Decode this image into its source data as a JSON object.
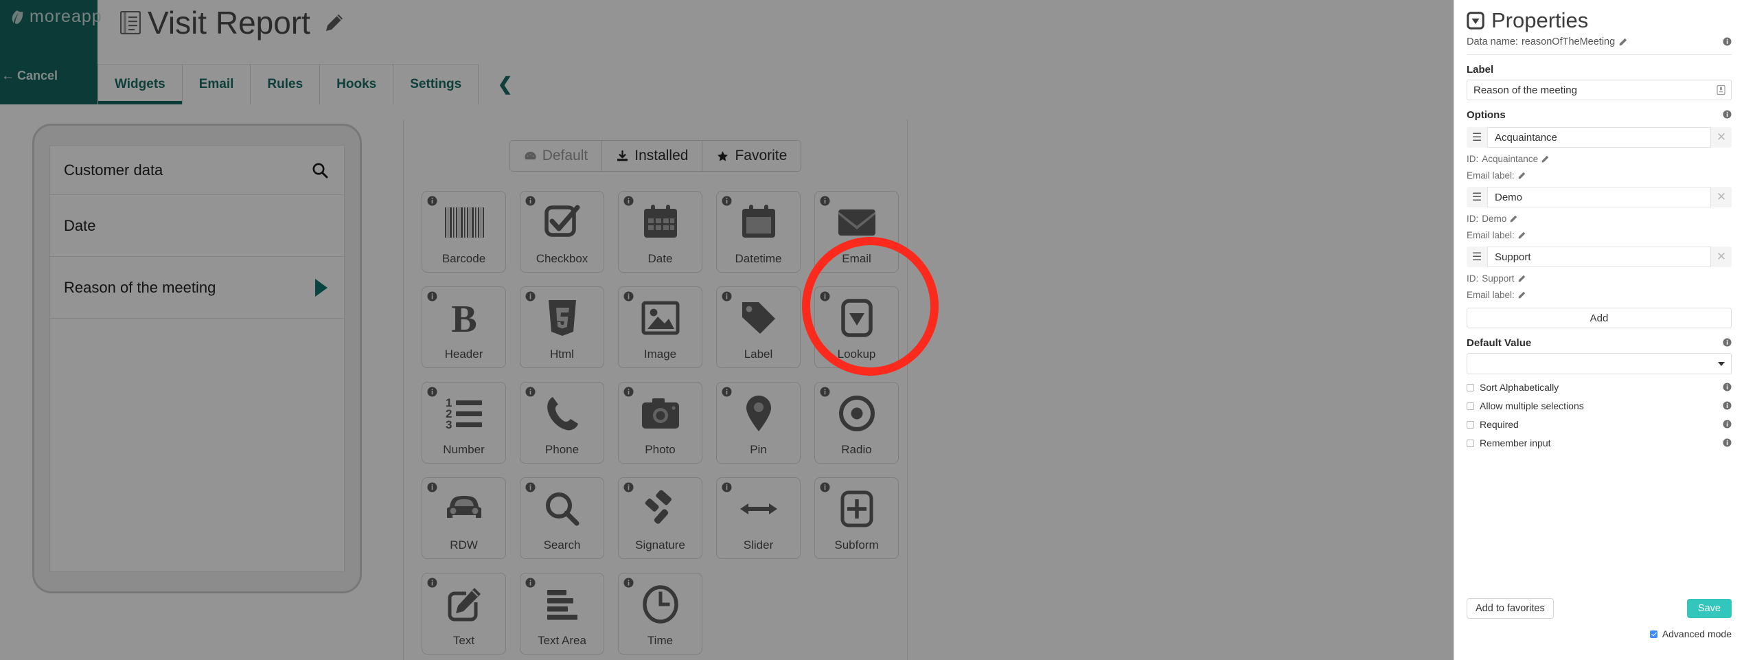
{
  "brand": {
    "name": "moreapp",
    "logo_icon": "leaf-icon",
    "cancel_label": "Cancel",
    "cancel_icon": "arrow-left-icon"
  },
  "header": {
    "title": "Visit Report",
    "title_icon": "document-icon",
    "edit_icon": "pencil-icon",
    "tabs": [
      {
        "label": "Widgets",
        "active": true
      },
      {
        "label": "Email",
        "active": false
      },
      {
        "label": "Rules",
        "active": false
      },
      {
        "label": "Hooks",
        "active": false
      },
      {
        "label": "Settings",
        "active": false
      }
    ],
    "collapse_icon": "chevron-left-icon"
  },
  "preview": {
    "header_row": {
      "label": "Customer data",
      "icon": "search-icon"
    },
    "rows": [
      {
        "label": "Date",
        "caret": false
      },
      {
        "label": "Reason of the meeting",
        "caret": true
      }
    ]
  },
  "widget_panel": {
    "filters": [
      {
        "label": "Default",
        "icon": "dashboard-icon",
        "state": "disabled"
      },
      {
        "label": "Installed",
        "icon": "download-icon",
        "state": "active"
      },
      {
        "label": "Favorite",
        "icon": "star-icon",
        "state": "normal"
      }
    ],
    "widgets": [
      {
        "label": "Barcode",
        "icon": "barcode-icon"
      },
      {
        "label": "Checkbox",
        "icon": "checkbox-icon"
      },
      {
        "label": "Date",
        "icon": "calendar-icon"
      },
      {
        "label": "Datetime",
        "icon": "calendar-blank-icon"
      },
      {
        "label": "Email",
        "icon": "envelope-icon"
      },
      {
        "label": "Header",
        "icon": "bold-b-icon"
      },
      {
        "label": "Html",
        "icon": "html5-icon"
      },
      {
        "label": "Image",
        "icon": "image-icon"
      },
      {
        "label": "Label",
        "icon": "tag-icon"
      },
      {
        "label": "Lookup",
        "icon": "lookup-dropdown-icon",
        "highlighted": true
      },
      {
        "label": "Number",
        "icon": "numbered-list-icon"
      },
      {
        "label": "Phone",
        "icon": "phone-icon"
      },
      {
        "label": "Photo",
        "icon": "camera-icon"
      },
      {
        "label": "Pin",
        "icon": "map-pin-icon"
      },
      {
        "label": "Radio",
        "icon": "radio-button-icon"
      },
      {
        "label": "RDW",
        "icon": "car-icon"
      },
      {
        "label": "Search",
        "icon": "magnifier-icon"
      },
      {
        "label": "Signature",
        "icon": "gavel-icon"
      },
      {
        "label": "Slider",
        "icon": "double-arrow-icon"
      },
      {
        "label": "Subform",
        "icon": "plus-square-icon"
      },
      {
        "label": "Text",
        "icon": "pencil-square-icon"
      },
      {
        "label": "Text Area",
        "icon": "lines-icon"
      },
      {
        "label": "Time",
        "icon": "clock-icon"
      }
    ],
    "info_icon": "info-icon",
    "highlight_color": "#fb2a1c"
  },
  "properties": {
    "title": "Properties",
    "title_icon": "lookup-dropdown-icon",
    "data_name_key": "Data name:",
    "data_name_value": "reasonOfTheMeeting",
    "info_icon": "info-icon",
    "edit_icon": "pencil-icon",
    "label_section": {
      "title": "Label",
      "value": "Reason of the meeting",
      "tail_icon": "translate-icon"
    },
    "options_section": {
      "title": "Options",
      "items": [
        {
          "value": "Acquaintance",
          "id_label": "ID:",
          "id_value": "Acquaintance",
          "email_label": "Email label:",
          "email_value": "",
          "drag_icon": "drag-handle-icon",
          "remove_icon": "close-icon"
        },
        {
          "value": "Demo",
          "id_label": "ID:",
          "id_value": "Demo",
          "email_label": "Email label:",
          "email_value": "",
          "drag_icon": "drag-handle-icon",
          "remove_icon": "close-icon"
        },
        {
          "value": "Support",
          "id_label": "ID:",
          "id_value": "Support",
          "email_label": "Email label:",
          "email_value": "",
          "drag_icon": "drag-handle-icon",
          "remove_icon": "close-icon"
        }
      ],
      "add_label": "Add"
    },
    "default_value": {
      "title": "Default Value",
      "value": "",
      "chevron_icon": "chevron-down-icon"
    },
    "checkboxes": [
      {
        "label": "Sort Alphabetically",
        "checked": false
      },
      {
        "label": "Allow multiple selections",
        "checked": false
      },
      {
        "label": "Required",
        "checked": false
      },
      {
        "label": "Remember input",
        "checked": false
      }
    ],
    "footer": {
      "favorites_label": "Add to favorites",
      "save_label": "Save",
      "save_color": "#32c6bd",
      "advanced_label": "Advanced mode",
      "advanced_checked": true,
      "advanced_color": "#3d8bfd"
    }
  }
}
